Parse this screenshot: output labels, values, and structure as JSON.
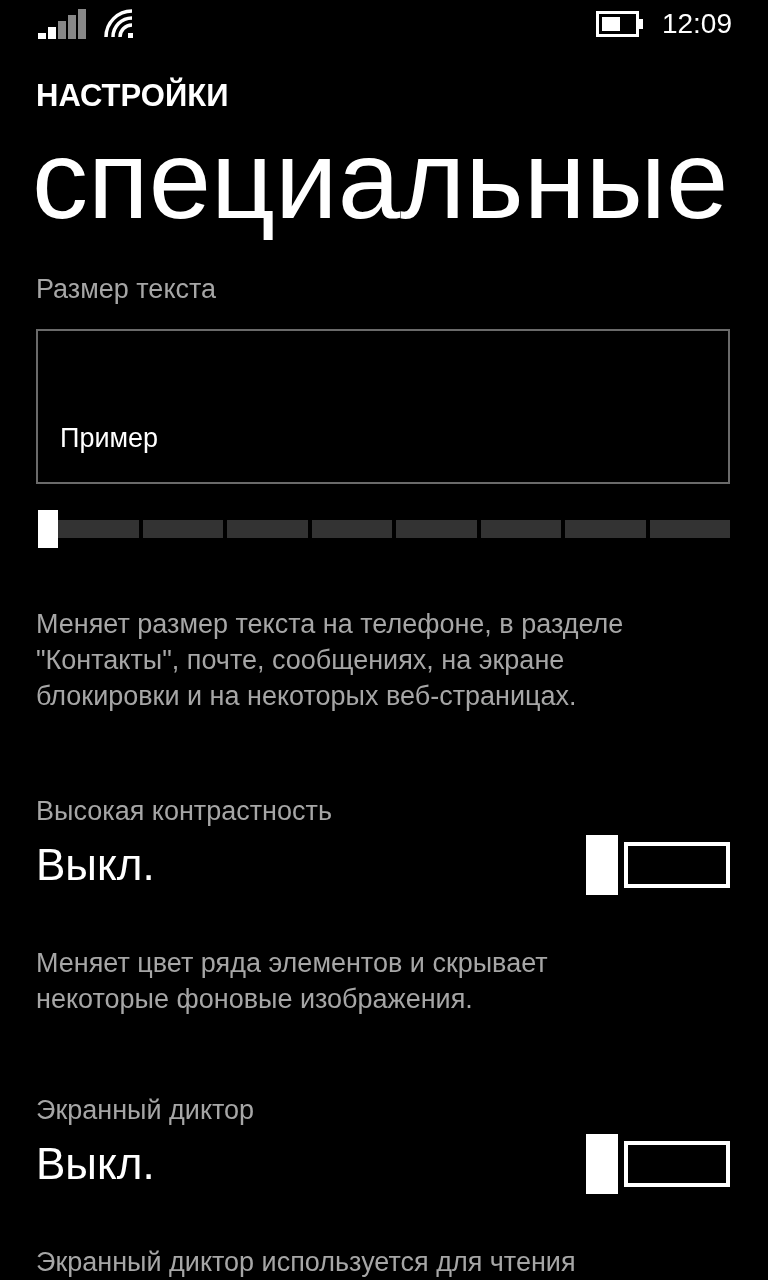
{
  "status_bar": {
    "time": "12:09"
  },
  "header": "НАСТРОЙКИ",
  "title": "специальные",
  "text_size": {
    "label": "Размер текста",
    "sample": "Пример",
    "level": 0,
    "description": "Меняет размер текста на телефоне, в разделе \"Контакты\", почте, сообщениях, на экране блокировки и на некоторых веб-страницах."
  },
  "toggles": [
    {
      "label": "Высокая контрастность",
      "state_text": "Выкл.",
      "on": false,
      "description": "Меняет цвет ряда элементов и скрывает некоторые фоновые изображения."
    },
    {
      "label": "Экранный диктор",
      "state_text": "Выкл.",
      "on": false,
      "description": "Экранный диктор используется для чтения"
    }
  ]
}
